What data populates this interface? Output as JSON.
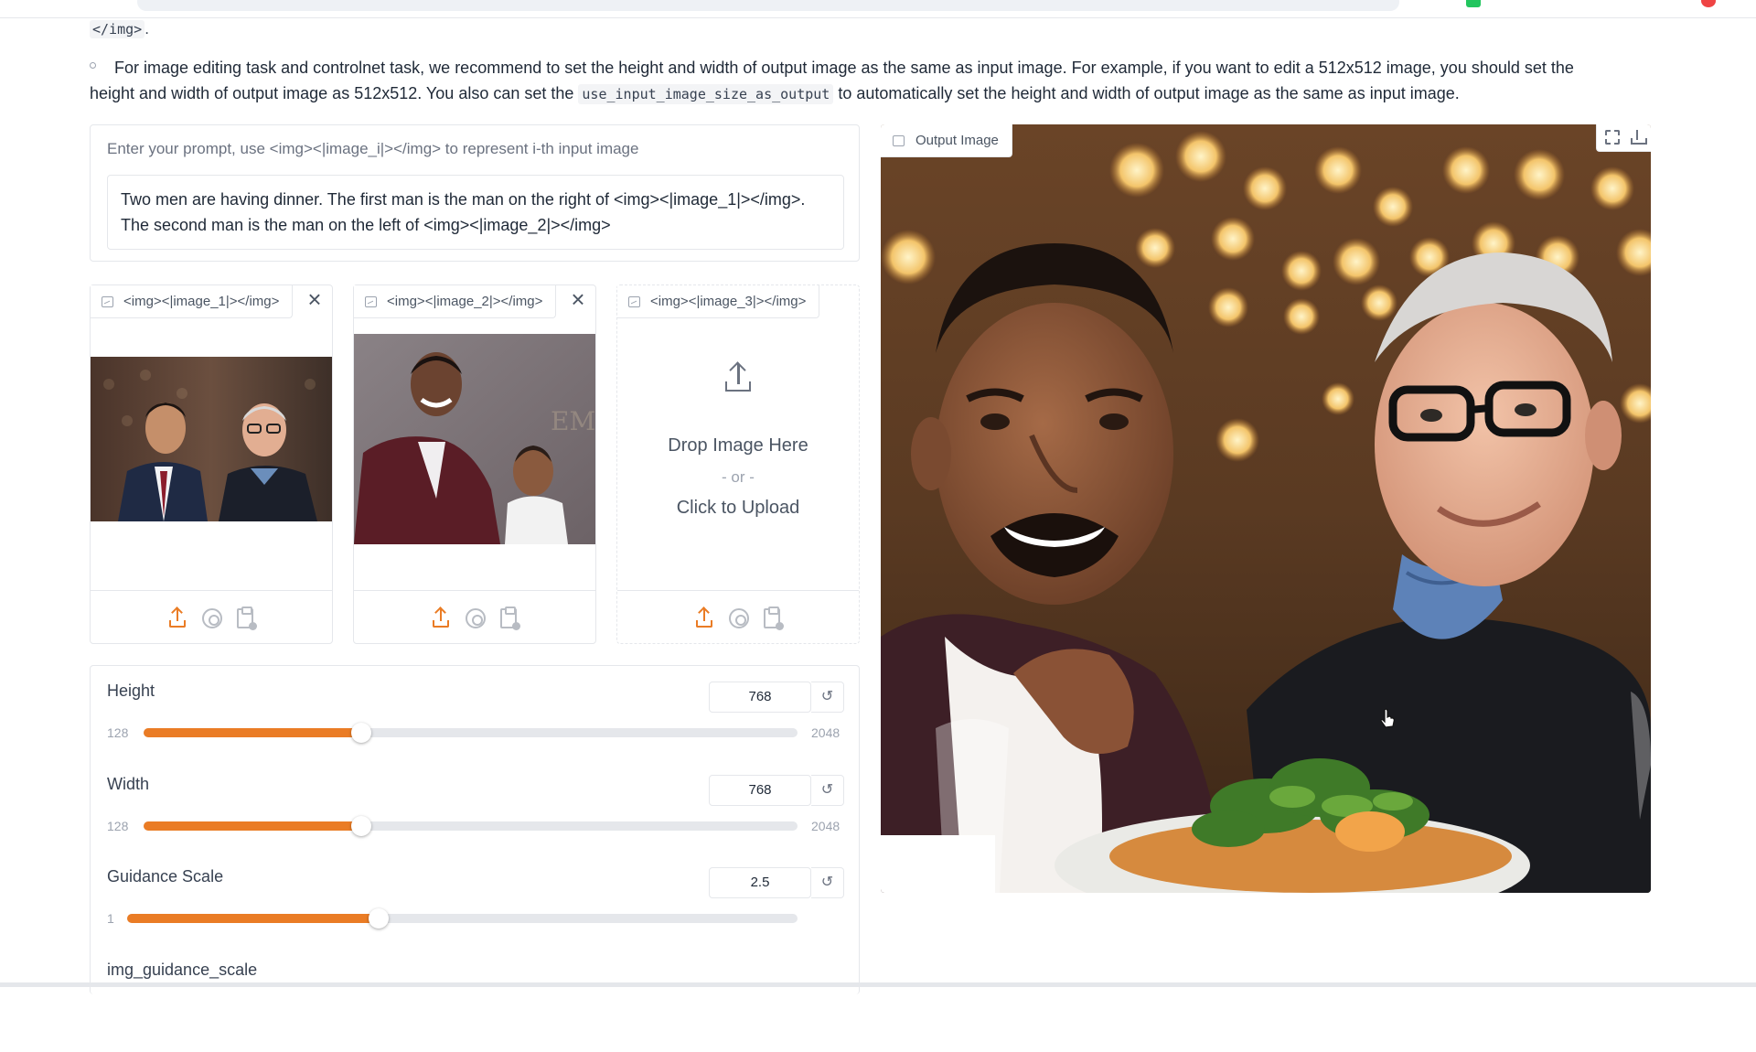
{
  "doc": {
    "line0_code": "</img>",
    "line0_end": ".",
    "bullet_part1": "For image editing task and controlnet task, we recommend to set the height and width of output image as the same as input image. For example, if you want to edit a 512x512 image, you should set the",
    "bullet_part2a": "height and width of output image as 512x512. You also can set the ",
    "bullet_code": "use_input_image_size_as_output",
    "bullet_part2b": " to automatically set the height and width of output image as the same as input image."
  },
  "prompt": {
    "label": "Enter your prompt, use <img><|image_i|></img> to represent i-th input image",
    "value_line1": "Two men are having dinner. The first man is the man on the right of <img><|image_1|></img>.",
    "value_line2": "The second man is the man on the left of <img><|image_2|></img>"
  },
  "images": [
    {
      "label": "<img><|image_1|></img>",
      "has_image": true
    },
    {
      "label": "<img><|image_2|></img>",
      "has_image": true
    },
    {
      "label": "<img><|image_3|></img>",
      "has_image": false,
      "drop": "Drop Image Here",
      "or": "- or -",
      "click": "Click to Upload"
    }
  ],
  "sliders": [
    {
      "label": "Height",
      "value": "768",
      "min": "128",
      "max": "2048",
      "fraction": 0.333
    },
    {
      "label": "Width",
      "value": "768",
      "min": "128",
      "max": "2048",
      "fraction": 0.333
    },
    {
      "label": "Guidance Scale",
      "value": "2.5",
      "min": "1",
      "max": "",
      "fraction": 0.375
    },
    {
      "label": "img_guidance_scale",
      "value": "",
      "min": "",
      "max": "",
      "fraction": 0
    }
  ],
  "output": {
    "label": "Output Image"
  },
  "icons": {
    "reset": "↺",
    "close": "×"
  },
  "colors": {
    "accent": "#ea7c25",
    "border": "#e5e7eb"
  }
}
